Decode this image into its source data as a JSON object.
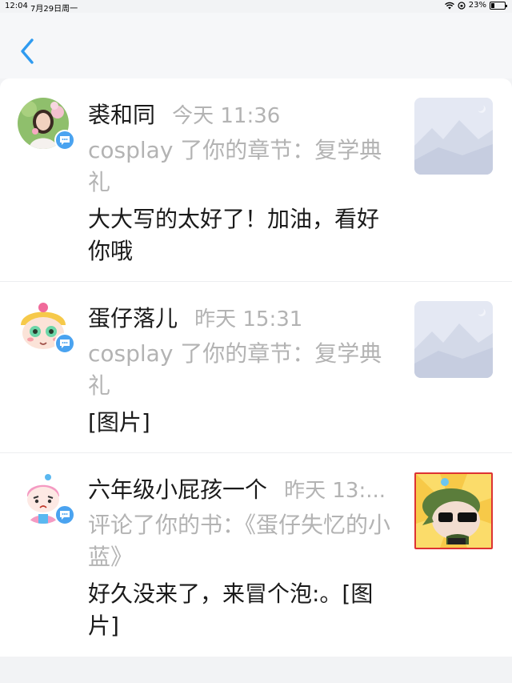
{
  "status_bar": {
    "time": "12:04",
    "date": "7月29日周一",
    "battery": "23%"
  },
  "header": {
    "back_icon": "chevron-left-icon",
    "accent_color": "#2f9bf0"
  },
  "notifications": [
    {
      "name": "裘和同",
      "time": "今天 11:36",
      "action": "cosplay 了你的章节：复学典礼",
      "message": "大大写的太好了！加油，看好你哦",
      "thumbnail": "placeholder-image"
    },
    {
      "name": "蛋仔落儿",
      "time": "昨天 15:31",
      "action": "cosplay 了你的章节：复学典礼",
      "message": "[图片]",
      "thumbnail": "placeholder-image"
    },
    {
      "name": "六年级小屁孩一个",
      "time": "昨天 13:...",
      "action": "评论了你的书：《蛋仔失忆的小蓝》",
      "message": "好久没来了，来冒个泡:。[图片]",
      "thumbnail": "book-cover-image"
    }
  ]
}
